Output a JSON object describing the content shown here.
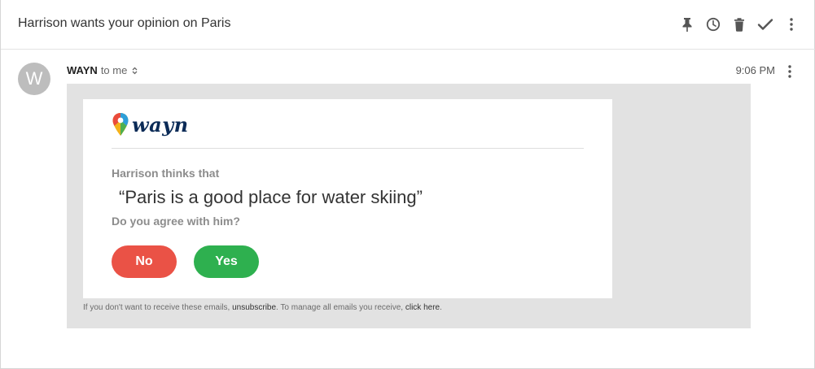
{
  "header": {
    "subject": "Harrison wants your opinion on Paris",
    "actions": [
      "pin-icon",
      "snooze-icon",
      "trash-icon",
      "check-icon",
      "more-vert-icon"
    ]
  },
  "message": {
    "avatar_letter": "W",
    "sender": "WAYN",
    "recipient": "to me",
    "time": "9:06 PM"
  },
  "email": {
    "logo_text": "wayn",
    "lead": "Harrison thinks that",
    "quote": "“Paris is a good place for water skiing”",
    "question": "Do you agree with him?",
    "no_label": "No",
    "yes_label": "Yes",
    "footer": {
      "text1": "If you don't want to receive these emails, ",
      "unsubscribe": "unsubscribe",
      "text2": ". To manage all emails you receive, ",
      "click_here": "click here",
      "text3": "."
    }
  },
  "colors": {
    "no_button": "#ea5246",
    "yes_button": "#2eb04f",
    "logo_text": "#0b2b57",
    "email_background": "#e2e2e2"
  }
}
